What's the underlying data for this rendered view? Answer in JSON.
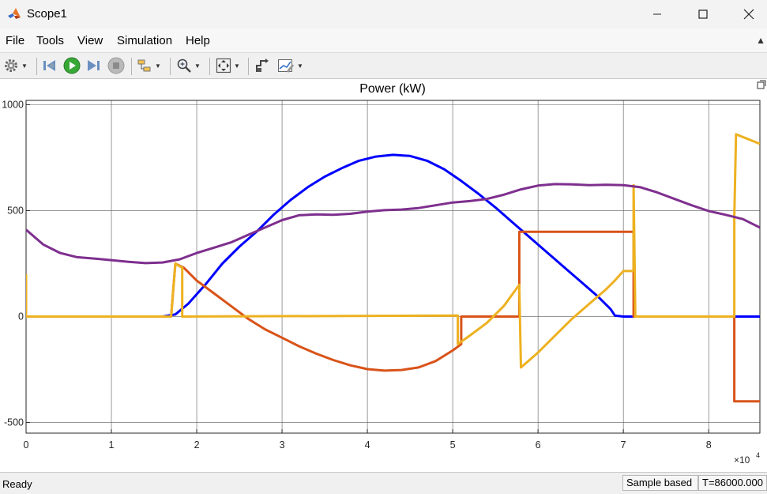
{
  "window": {
    "title": "Scope1"
  },
  "menu": {
    "items": [
      "File",
      "Tools",
      "View",
      "Simulation",
      "Help"
    ]
  },
  "toolbar": {
    "icons": [
      "settings-icon",
      "step-back-icon",
      "run-icon",
      "step-forward-icon",
      "stop-icon",
      "highlight-block-icon",
      "zoom-icon",
      "fit-to-view-icon",
      "style-icon",
      "measurements-icon"
    ]
  },
  "status": {
    "text": "Ready",
    "mode": "Sample based",
    "time": "T=86000.000"
  },
  "chart_data": {
    "type": "line",
    "title": "Power  (kW)",
    "xlabel": "",
    "ylabel": "",
    "x_multiplier": "×10",
    "x_multiplier_exp": "4",
    "xlim": [
      0,
      8.6
    ],
    "ylim": [
      -550,
      1020
    ],
    "xticks": [
      0,
      1,
      2,
      3,
      4,
      5,
      6,
      7,
      8
    ],
    "yticks": [
      -500,
      0,
      500,
      1000
    ],
    "grid": true,
    "series": [
      {
        "color": "#0000ff",
        "points": [
          [
            0,
            0
          ],
          [
            1.6,
            0
          ],
          [
            1.75,
            10
          ],
          [
            1.9,
            60
          ],
          [
            2.1,
            150
          ],
          [
            2.3,
            250
          ],
          [
            2.5,
            330
          ],
          [
            2.7,
            400
          ],
          [
            2.9,
            480
          ],
          [
            3.1,
            550
          ],
          [
            3.3,
            610
          ],
          [
            3.5,
            660
          ],
          [
            3.7,
            700
          ],
          [
            3.9,
            735
          ],
          [
            4.1,
            755
          ],
          [
            4.3,
            763
          ],
          [
            4.5,
            758
          ],
          [
            4.7,
            735
          ],
          [
            4.9,
            695
          ],
          [
            5.1,
            640
          ],
          [
            5.3,
            580
          ],
          [
            5.5,
            515
          ],
          [
            5.7,
            445
          ],
          [
            5.9,
            375
          ],
          [
            6.1,
            305
          ],
          [
            6.3,
            235
          ],
          [
            6.5,
            165
          ],
          [
            6.7,
            95
          ],
          [
            6.85,
            35
          ],
          [
            6.9,
            5
          ],
          [
            7.0,
            0
          ],
          [
            7.15,
            0
          ],
          [
            8.6,
            0
          ]
        ]
      },
      {
        "color": "#d95319",
        "points": [
          [
            0,
            0
          ],
          [
            1.7,
            0
          ],
          [
            1.75,
            250
          ],
          [
            1.85,
            230
          ],
          [
            2.0,
            170
          ],
          [
            2.2,
            110
          ],
          [
            2.4,
            50
          ],
          [
            2.6,
            -10
          ],
          [
            2.8,
            -60
          ],
          [
            3.0,
            -100
          ],
          [
            3.2,
            -140
          ],
          [
            3.4,
            -175
          ],
          [
            3.6,
            -205
          ],
          [
            3.8,
            -230
          ],
          [
            4.0,
            -248
          ],
          [
            4.2,
            -255
          ],
          [
            4.4,
            -252
          ],
          [
            4.6,
            -240
          ],
          [
            4.8,
            -210
          ],
          [
            5.0,
            -160
          ],
          [
            5.1,
            -130
          ],
          [
            5.1,
            0
          ],
          [
            5.78,
            0
          ],
          [
            5.78,
            400
          ],
          [
            7.12,
            400
          ],
          [
            7.12,
            0
          ],
          [
            8.3,
            0
          ],
          [
            8.3,
            -400
          ],
          [
            8.6,
            -400
          ]
        ]
      },
      {
        "color": "#edb120",
        "points": [
          [
            0,
            200
          ],
          [
            0,
            0
          ],
          [
            1.7,
            0
          ],
          [
            1.75,
            250
          ],
          [
            1.83,
            230
          ],
          [
            1.83,
            0
          ],
          [
            5.06,
            5
          ],
          [
            5.06,
            -130
          ],
          [
            5.2,
            -90
          ],
          [
            5.4,
            -30
          ],
          [
            5.6,
            50
          ],
          [
            5.78,
            150
          ],
          [
            5.8,
            -240
          ],
          [
            6.0,
            -170
          ],
          [
            6.2,
            -90
          ],
          [
            6.4,
            -10
          ],
          [
            6.6,
            60
          ],
          [
            6.8,
            130
          ],
          [
            6.9,
            170
          ],
          [
            7.0,
            215
          ],
          [
            7.12,
            215
          ],
          [
            7.12,
            620
          ],
          [
            7.14,
            0
          ],
          [
            8.3,
            0
          ],
          [
            8.3,
            470
          ],
          [
            8.32,
            860
          ],
          [
            8.6,
            815
          ]
        ]
      },
      {
        "color": "#7e2f8e",
        "points": [
          [
            0,
            410
          ],
          [
            0.2,
            340
          ],
          [
            0.4,
            300
          ],
          [
            0.6,
            280
          ],
          [
            0.9,
            270
          ],
          [
            1.2,
            258
          ],
          [
            1.4,
            252
          ],
          [
            1.6,
            255
          ],
          [
            1.8,
            270
          ],
          [
            2.0,
            300
          ],
          [
            2.2,
            325
          ],
          [
            2.4,
            350
          ],
          [
            2.6,
            385
          ],
          [
            2.8,
            420
          ],
          [
            3.0,
            455
          ],
          [
            3.2,
            478
          ],
          [
            3.4,
            482
          ],
          [
            3.6,
            480
          ],
          [
            3.8,
            485
          ],
          [
            4.0,
            495
          ],
          [
            4.2,
            502
          ],
          [
            4.4,
            505
          ],
          [
            4.6,
            512
          ],
          [
            4.8,
            525
          ],
          [
            5.0,
            538
          ],
          [
            5.2,
            545
          ],
          [
            5.4,
            555
          ],
          [
            5.6,
            575
          ],
          [
            5.8,
            600
          ],
          [
            6.0,
            618
          ],
          [
            6.2,
            625
          ],
          [
            6.4,
            624
          ],
          [
            6.6,
            620
          ],
          [
            6.8,
            622
          ],
          [
            7.0,
            620
          ],
          [
            7.2,
            610
          ],
          [
            7.4,
            585
          ],
          [
            7.6,
            555
          ],
          [
            7.8,
            525
          ],
          [
            8.0,
            498
          ],
          [
            8.2,
            480
          ],
          [
            8.4,
            460
          ],
          [
            8.6,
            420
          ]
        ]
      }
    ]
  }
}
